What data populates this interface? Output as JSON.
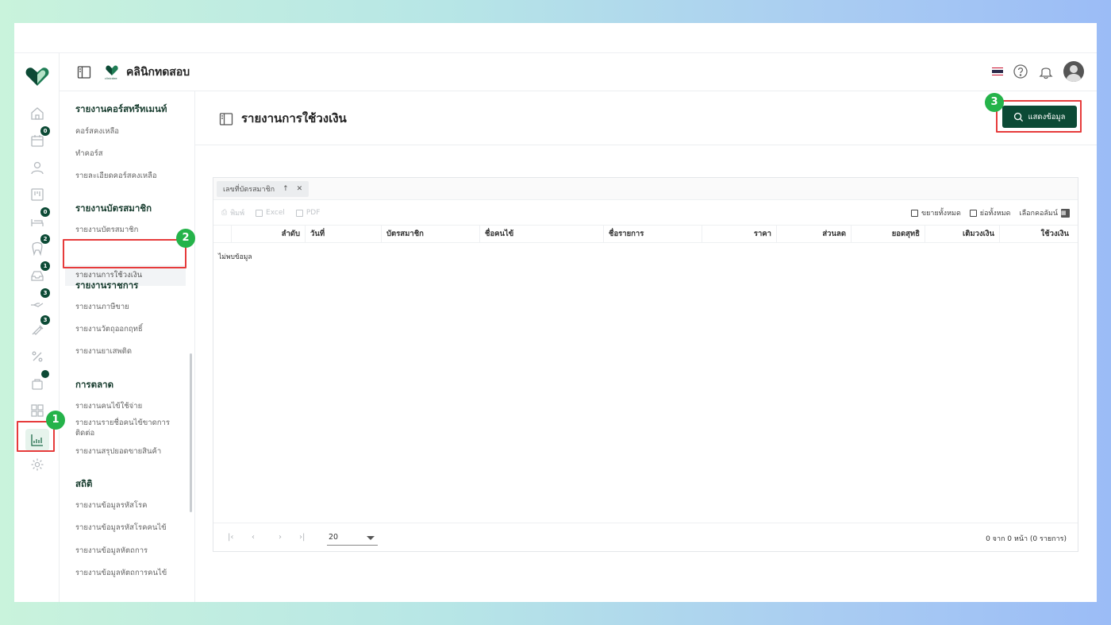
{
  "header": {
    "clinic_logo_caption": "clinicdee",
    "clinic_name": "คลินิกทดสอบ"
  },
  "rail": {
    "badges": [
      "0",
      "0",
      "2",
      "1",
      "3",
      "3"
    ]
  },
  "submenu": {
    "sections": [
      {
        "title": "รายงานคอร์สทรีทเมนท์",
        "items": [
          "คอร์สคงเหลือ",
          "ทำคอร์ส",
          "รายละเอียดคอร์สคงเหลือ"
        ]
      },
      {
        "title": "รายงานบัตรสมาชิก",
        "items": [
          "รายงานบัตรสมาชิก",
          "รายงานการใช้วงเงิน"
        ]
      },
      {
        "title": "รายงานราชการ",
        "items": [
          "รายงานภาษีขาย",
          "รายงานวัตถุออกฤทธิ์",
          "รายงานยาเสพติด"
        ]
      },
      {
        "title": "การตลาด",
        "items": [
          "รายงานคนไข้ใช้จ่าย",
          "รายงานรายชื่อคนไข้ขาดการติดต่อ",
          "รายงานสรุปยอดขายสินค้า"
        ]
      },
      {
        "title": "สถิติ",
        "items": [
          "รายงานข้อมูลรหัสโรค",
          "รายงานข้อมูลรหัสโรคคนไข้",
          "รายงานข้อมูลหัตถการ",
          "รายงานข้อมูลหัตถการคนไข้"
        ]
      }
    ]
  },
  "main": {
    "title": "รายงานการใช้วงเงิน",
    "show_button": "แสดงข้อมูล"
  },
  "grid": {
    "group_chip": "เลขที่บัตรสมาชิก",
    "toolbar_left": [
      "พิมพ์",
      "Excel",
      "PDF"
    ],
    "toolbar_right": [
      "ขยายทั้งหมด",
      "ย่อทั้งหมด",
      "เลือกคอลัมน์"
    ],
    "columns": [
      "ลำดับ",
      "วันที่",
      "บัตรสมาชิก",
      "ชื่อคนไข้",
      "ชื่อรายการ",
      "ราคา",
      "ส่วนลด",
      "ยอดสุทธิ",
      "เติมวงเงิน",
      "ใช้วงเงิน"
    ],
    "empty_text": "ไม่พบข้อมูล",
    "page_size": "20",
    "page_info": "0 จาก 0 หน้า (0 รายการ)"
  },
  "annotations": [
    "1",
    "2",
    "3"
  ],
  "colors": {
    "brand": "#0c4a35",
    "highlight": "#e63b3b",
    "step": "#25b34a"
  }
}
